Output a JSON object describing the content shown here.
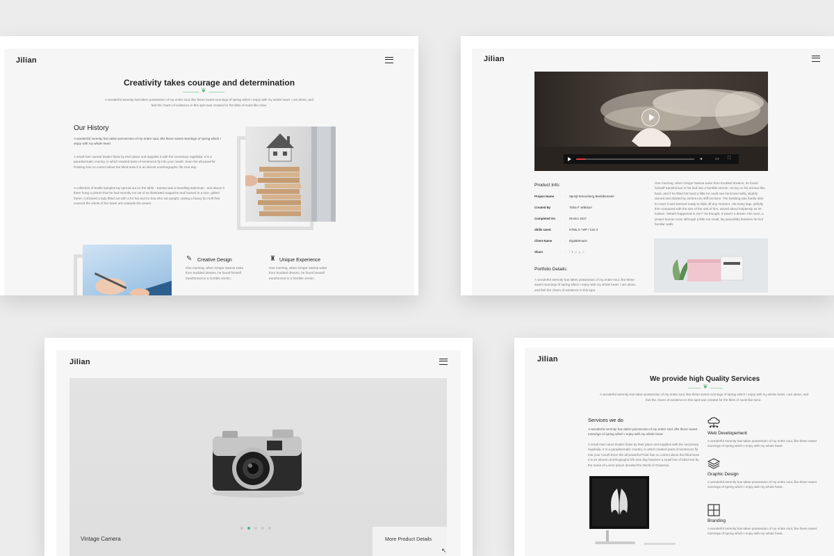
{
  "brand": "Jilian",
  "colors": {
    "accent": "#3fb97a",
    "background": "#ececec"
  },
  "about": {
    "title": "Creativity takes courage and determination",
    "intro_1": "A wonderful serenity has taken possession of my entire soul, like these sweet mornings of spring which I enjoy with my whole heart. I am alone, and",
    "intro_2": "feel the charm of existence in this spot was created for the bliss of souls like mine.",
    "history_title": "Our History",
    "history_lead": "A wonderful serenity has taken possession of my entire soul, like these sweet mornings of spring which I enjoy with my whole heart.",
    "history_p1": "A small river named Duden flows by their place and supplies it with the necessary regelialia. It is a paradisematic country, in which roasted parts of sentences fly into your mouth. Even the all-powerful Pointing has no control about the blind texts it is an almost unorthographic life One day.",
    "history_p2": "A collection of textile samples lay spread out on the table - Samsa was a travelling salesman - and above it there hung a picture that he had recently cut out of an illustrated magazine and housed in a nice, gilded frame. It showed a lady fitted out with a fur hat and fur boa who sat upright, raising a heavy fur muff that covered the whole of her lower arm towards the viewer.",
    "feature_1_title": "Creative Design",
    "feature_1_text": "One morning, when Gregor Samsa woke from troubled dreams, he found himself transformed in a horrible vermin.",
    "feature_2_title": "Unique Experience",
    "feature_2_text": "One morning, when Gregor Samsa woke from troubled dreams, he found himself transformed in a horrible vermin."
  },
  "project": {
    "info_title": "Product Info:",
    "rows": [
      {
        "key": "Project Name",
        "value": "Sprvijt Stroomberg Beeldhemeter"
      },
      {
        "key": "Created By",
        "value": "Tisha F. Wilkison"
      },
      {
        "key": "Completed On",
        "value": "05 Dec 2017"
      },
      {
        "key": "Skills Used",
        "value": "HTML 5 / WP / Css 3"
      },
      {
        "key": "Client Name",
        "value": "DigitalSmaze"
      }
    ],
    "share_label": "Share",
    "share_icons": [
      "facebook-icon",
      "twitter-icon",
      "pinterest-icon",
      "google-plus-icon",
      "skype-icon"
    ],
    "description": "One morning, when Gregor Samsa woke from troubled dreams, he found himself transformed in his bed into a horrible vermin. He lay on his armour-like back, and if he lifted his head a little he could see his brown belly, slightly domed and divided by arches into stiff sections. The bedding was hardly able to cover it and seemed ready to slide off any moment. His many legs, pitifully thin compared with the size of the rest of him, waved about helplessly as he looked. \"What's happened to me?\" he thought. It wasn't a dream. His room, a proper human room although a little too small, lay peacefully between its four familiar walls.",
    "portfolio_title": "Portfolio Details:",
    "portfolio_text": "A wonderful serenity has taken possession of my entire soul, like these sweet mornings of spring which I enjoy with my whole heart. I am alone, and feel the charm of existence in this spot."
  },
  "gallery": {
    "caption": "Vintage Camera",
    "cta": "More Product Details",
    "slide_count": 5,
    "active_slide": 2
  },
  "services": {
    "title": "We provide high Quality Services",
    "intro_1": "A wonderful serenity has taken possession of my entire soul, like these sweet mornings of spring which I enjoy with my whole heart. I am alone, and",
    "intro_2": "feel the charm of existence in this spot was created for the bliss of souls like mine.",
    "section_title": "Services we do",
    "lead": "A wonderful serenity has taken possession of my entire soul, like these sweet mornings of spring which I enjoy with my whole heart.",
    "body": "A small river name Duden flows by their place and supplies with the necessary regelialia. It is a paradisematic country, in which roasted parts of sentences fly into your mouth Even the all-powerful Point has no control about the blind texts it is an almost unorthographic life One day however a small line of blind text by the name of Lorem Ipsum decided the World of Grammar.",
    "items": [
      {
        "title": "Web Developement",
        "text": "A wonderful serenity has taken possession of my entire soul, like these sweet mornings of spring which I enjoy with my whole heart.",
        "icon": "cloud-network-icon"
      },
      {
        "title": "Graphic Design",
        "text": "A wonderful serenity has taken possession of my entire soul, like these sweet mornings of spring which I enjoy with my whole heart.",
        "icon": "layers-icon"
      },
      {
        "title": "Branding",
        "text": "A wonderful serenity has taken possession of my entire soul, like these sweet mornings of spring which I enjoy with my whole heart.",
        "icon": "grid-window-icon"
      }
    ]
  }
}
